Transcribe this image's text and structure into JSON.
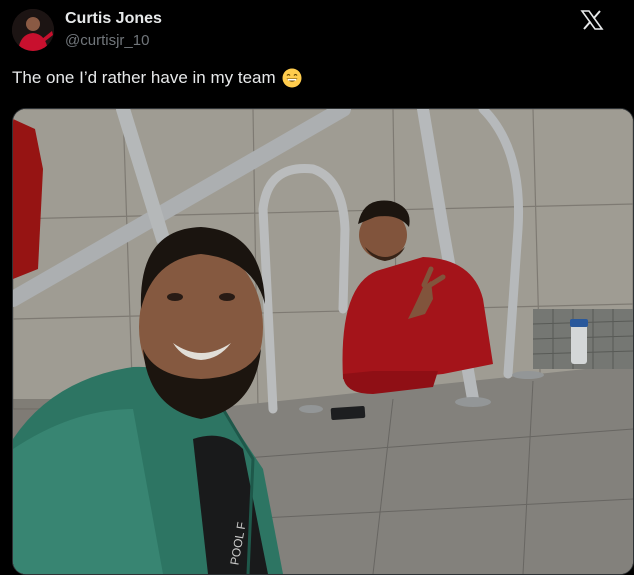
{
  "author": {
    "name": "Curtis Jones",
    "handle": "@curtisjr_10",
    "avatar_icon": "profile-photo"
  },
  "tweet": {
    "text": "The one I’d rather have in my team",
    "emoji_icon": "grinning-face-emoji"
  },
  "media": {
    "jacket_print": "POOL F"
  },
  "colors": {
    "background": "#000000",
    "name": "#e7e9ea",
    "handle": "#71767b"
  }
}
